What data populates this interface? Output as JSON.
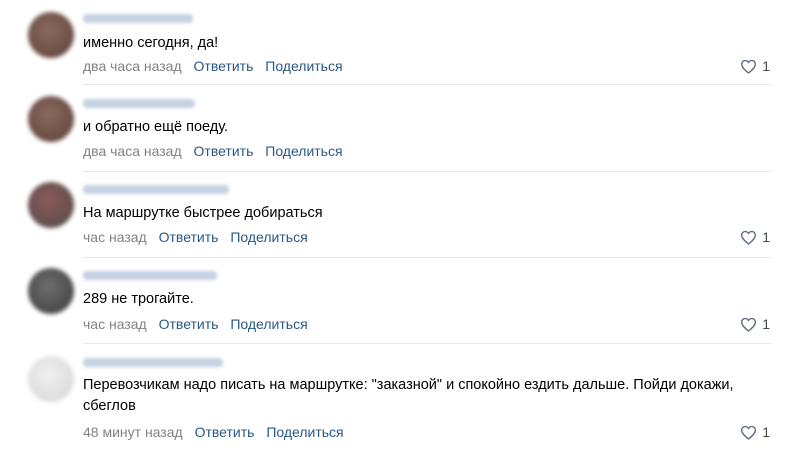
{
  "colors": {
    "link": "#2a5885",
    "meta": "#828282",
    "divider": "#e7e8ec"
  },
  "comments": [
    {
      "text": "именно сегодня, да!",
      "time": "два часа назад",
      "reply": "Ответить",
      "share": "Поделиться",
      "likes": "1"
    },
    {
      "text": "и обратно ещё поеду.",
      "time": "два часа назад",
      "reply": "Ответить",
      "share": "Поделиться",
      "likes": ""
    },
    {
      "text": "На маршрутке быстрее добираться",
      "time": "час назад",
      "reply": "Ответить",
      "share": "Поделиться",
      "likes": "1"
    },
    {
      "text": "289 не трогайте.",
      "time": "час назад",
      "reply": "Ответить",
      "share": "Поделиться",
      "likes": "1"
    },
    {
      "text": "Перевозчикам надо писать на маршрутке: \"заказной\" и спокойно ездить дальше. Пойди докажи, сбеглов",
      "time": "48 минут назад",
      "reply": "Ответить",
      "share": "Поделиться",
      "likes": "1"
    }
  ]
}
